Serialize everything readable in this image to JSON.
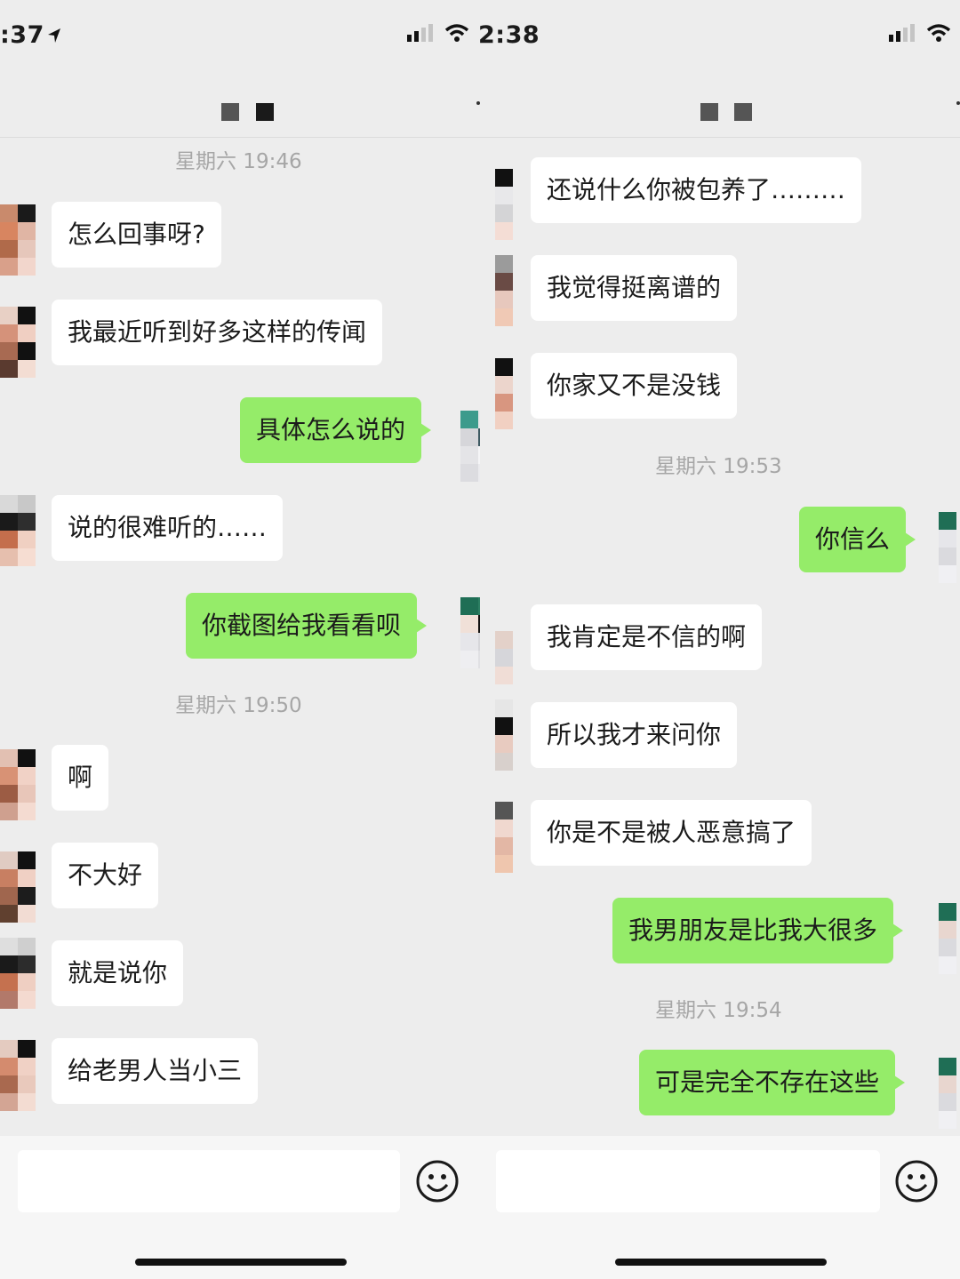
{
  "left": {
    "status_time": ":37",
    "messages": [
      {
        "type": "time",
        "text": "星期六 19:46"
      },
      {
        "type": "in",
        "text": "怎么回事呀?"
      },
      {
        "type": "in",
        "text": "我最近听到好多这样的传闻"
      },
      {
        "type": "out",
        "text": "具体怎么说的"
      },
      {
        "type": "in",
        "text": "说的很难听的……"
      },
      {
        "type": "out",
        "text": "你截图给我看看呗"
      },
      {
        "type": "time",
        "text": "星期六 19:50"
      },
      {
        "type": "in",
        "text": "啊"
      },
      {
        "type": "in",
        "text": "不大好"
      },
      {
        "type": "in",
        "text": "就是说你"
      },
      {
        "type": "in",
        "text": "给老男人当小三"
      }
    ]
  },
  "right": {
    "status_time": "2:38",
    "messages": [
      {
        "type": "in",
        "text": "还说什么你被包养了………"
      },
      {
        "type": "in",
        "text": "我觉得挺离谱的"
      },
      {
        "type": "in",
        "text": "你家又不是没钱"
      },
      {
        "type": "time",
        "text": "星期六 19:53"
      },
      {
        "type": "out",
        "text": "你信么"
      },
      {
        "type": "in",
        "text": "我肯定是不信的啊"
      },
      {
        "type": "in",
        "text": "所以我才来问你"
      },
      {
        "type": "in",
        "text": "你是不是被人恶意搞了"
      },
      {
        "type": "out",
        "text": "我男朋友是比我大很多"
      },
      {
        "type": "time",
        "text": "星期六 19:54"
      },
      {
        "type": "out",
        "text": "可是完全不存在这些"
      }
    ]
  },
  "icons": {
    "signal": "signal-icon",
    "wifi": "wifi-icon",
    "location": "location-arrow-icon",
    "emoji": "smiley-icon"
  },
  "colors": {
    "background": "#ededed",
    "incoming_bubble": "#ffffff",
    "outgoing_bubble": "#95ec69",
    "timestamp": "#a6a6a6"
  }
}
